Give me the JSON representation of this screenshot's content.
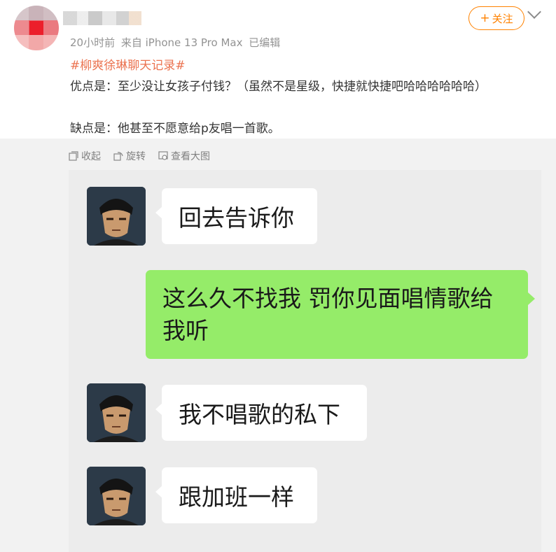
{
  "post": {
    "meta": {
      "time": "20小时前",
      "source": "来自 iPhone 13 Pro Max",
      "edited": "已编辑"
    },
    "follow_label": "关注",
    "hashtag": "#柳爽徐琳聊天记录#",
    "lines": [
      "优点是：至少没让女孩子付钱？（虽然不是星级，快捷就快捷吧哈哈哈哈哈哈）",
      "缺点是：他甚至不愿意给p友唱一首歌。"
    ]
  },
  "image_tools": {
    "collapse": "收起",
    "rotate": "旋转",
    "view_large": "查看大图"
  },
  "chat": {
    "messages": [
      {
        "side": "left",
        "text": "回去告诉你"
      },
      {
        "side": "right",
        "text": "这么久不找我 罚你见面唱情歌给我听"
      },
      {
        "side": "left",
        "text": "我不唱歌的私下"
      },
      {
        "side": "left",
        "text": "跟加班一样"
      }
    ]
  },
  "colors": {
    "accent": "#ff8200",
    "hashtag": "#eb7350",
    "bubble_green": "#95ec69",
    "chat_bg": "#ececec"
  }
}
